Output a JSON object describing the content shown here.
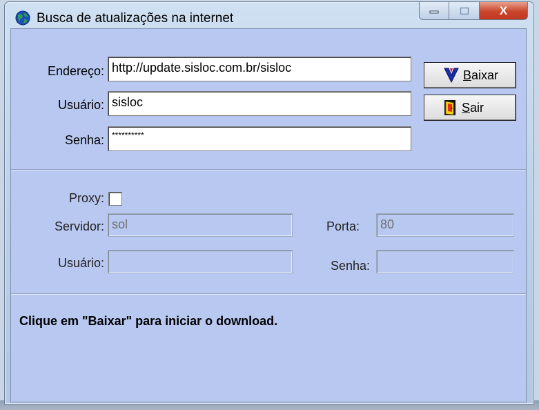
{
  "window": {
    "title": "Busca de atualizações na internet",
    "close_glyph": "X"
  },
  "form": {
    "address": {
      "label": "Endereço:",
      "value": "http://update.sisloc.com.br/sisloc"
    },
    "user": {
      "label": "Usuário:",
      "value": "sisloc"
    },
    "password": {
      "label": "Senha:",
      "value": "**********"
    }
  },
  "buttons": {
    "download": {
      "accel": "B",
      "rest": "aixar",
      "icon": "down-arrow-icon"
    },
    "exit": {
      "accel": "S",
      "rest": "air",
      "icon": "exit-door-icon"
    }
  },
  "proxy": {
    "label": "Proxy:",
    "checked": false,
    "server": {
      "label": "Servidor:",
      "value": "sol"
    },
    "port": {
      "label": "Porta:",
      "value": "80"
    },
    "user": {
      "label": "Usuário:",
      "value": ""
    },
    "password": {
      "label": "Senha:",
      "value": ""
    }
  },
  "status": "Clique em \"Baixar\" para iniciar o download.",
  "colors": {
    "client_bg": "#b8c8f0",
    "close_button": "#c9452b"
  }
}
